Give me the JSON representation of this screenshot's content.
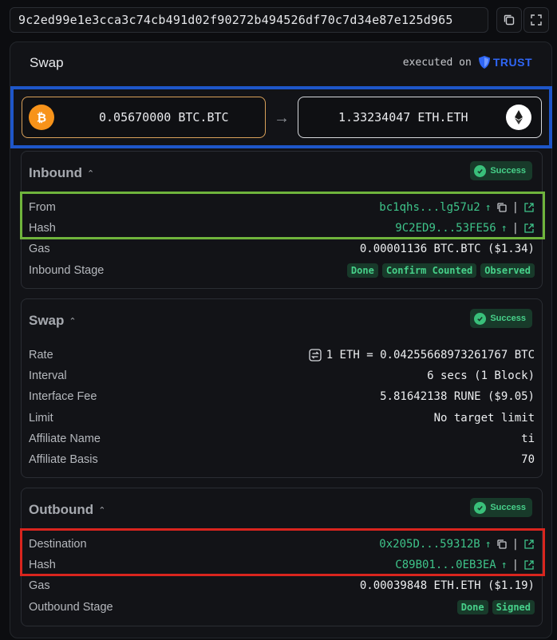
{
  "tx_hash": "9c2ed99e1e3cca3c74cb491d02f90272b494526df70c7d34e87e125d965",
  "card": {
    "title": "Swap",
    "executed_on": "executed on",
    "provider": "TRUST"
  },
  "swap_summary": {
    "from_amount": "0.05670000 BTC.BTC",
    "to_amount": "1.33234047 ETH.ETH",
    "arrow": "→"
  },
  "inbound": {
    "title": "Inbound",
    "status": "Success",
    "from_label": "From",
    "from_value": "bc1qhs...lg57u2",
    "hash_label": "Hash",
    "hash_value": "9C2ED9...53FE56",
    "gas_label": "Gas",
    "gas_value": "0.00001136 BTC.BTC ($1.34)",
    "stage_label": "Inbound Stage",
    "stages": [
      "Done",
      "Confirm Counted",
      "Observed"
    ]
  },
  "swap": {
    "title": "Swap",
    "status": "Success",
    "rate_label": "Rate",
    "rate_value": "1 ETH = 0.04255668973261767 BTC",
    "interval_label": "Interval",
    "interval_value": "6 secs (1 Block)",
    "fee_label": "Interface Fee",
    "fee_value": "5.81642138 RUNE ($9.05)",
    "limit_label": "Limit",
    "limit_value": "No target limit",
    "aff_name_label": "Affiliate Name",
    "aff_name_value": "ti",
    "aff_basis_label": "Affiliate Basis",
    "aff_basis_value": "70"
  },
  "outbound": {
    "title": "Outbound",
    "status": "Success",
    "dest_label": "Destination",
    "dest_value": "0x205D...59312B",
    "hash_label": "Hash",
    "hash_value": "C89B01...0EB3EA",
    "gas_label": "Gas",
    "gas_value": "0.00039848 ETH.ETH ($1.19)",
    "stage_label": "Outbound Stage",
    "stages": [
      "Done",
      "Signed"
    ]
  },
  "colors": {
    "accent_green": "#3ec48a",
    "btc_orange": "#f7931a",
    "highlight_blue": "#1e56c9",
    "highlight_green": "#6fb43c",
    "highlight_red": "#d9251e"
  }
}
